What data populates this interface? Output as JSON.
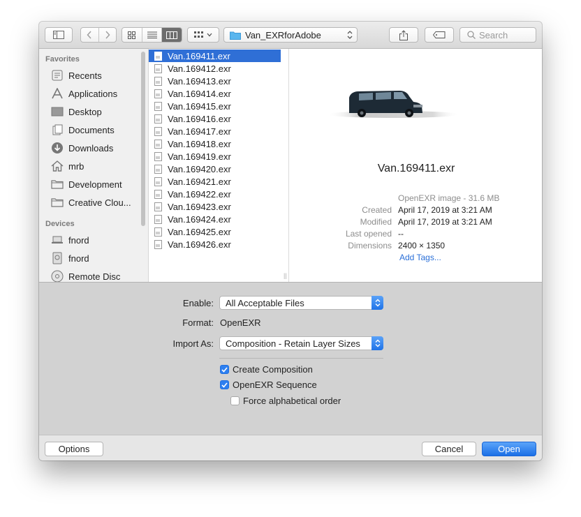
{
  "toolbar": {
    "path_label": "Van_EXRforAdobe",
    "search_placeholder": "Search"
  },
  "sidebar": {
    "favorites_header": "Favorites",
    "favorites": [
      {
        "label": "Recents",
        "icon": "recents-icon"
      },
      {
        "label": "Applications",
        "icon": "applications-icon"
      },
      {
        "label": "Desktop",
        "icon": "desktop-icon"
      },
      {
        "label": "Documents",
        "icon": "documents-icon"
      },
      {
        "label": "Downloads",
        "icon": "downloads-icon"
      },
      {
        "label": "mrb",
        "icon": "home-icon"
      },
      {
        "label": "Development",
        "icon": "folder-icon"
      },
      {
        "label": "Creative Clou...",
        "icon": "folder-icon"
      }
    ],
    "devices_header": "Devices",
    "devices": [
      {
        "label": "fnord",
        "icon": "laptop-icon"
      },
      {
        "label": "fnord",
        "icon": "drive-icon"
      },
      {
        "label": "Remote Disc",
        "icon": "disc-icon"
      }
    ]
  },
  "files": [
    "Van.169411.exr",
    "Van.169412.exr",
    "Van.169413.exr",
    "Van.169414.exr",
    "Van.169415.exr",
    "Van.169416.exr",
    "Van.169417.exr",
    "Van.169418.exr",
    "Van.169419.exr",
    "Van.169420.exr",
    "Van.169421.exr",
    "Van.169422.exr",
    "Van.169423.exr",
    "Van.169424.exr",
    "Van.169425.exr",
    "Van.169426.exr"
  ],
  "selected_file_index": 0,
  "preview": {
    "name": "Van.169411.exr",
    "kind": "OpenEXR image - 31.6 MB",
    "created_label": "Created",
    "created": "April 17, 2019 at 3:21 AM",
    "modified_label": "Modified",
    "modified": "April 17, 2019 at 3:21 AM",
    "last_opened_label": "Last opened",
    "last_opened": "--",
    "dimensions_label": "Dimensions",
    "dimensions": "2400 × 1350",
    "add_tags": "Add Tags..."
  },
  "options": {
    "enable_label": "Enable:",
    "enable_value": "All Acceptable Files",
    "format_label": "Format:",
    "format_value": "OpenEXR",
    "import_as_label": "Import As:",
    "import_as_value": "Composition - Retain Layer Sizes",
    "create_composition": {
      "label": "Create Composition",
      "checked": true
    },
    "openexr_sequence": {
      "label": "OpenEXR Sequence",
      "checked": true
    },
    "force_alpha_order": {
      "label": "Force alphabetical order",
      "checked": false
    }
  },
  "buttons": {
    "options": "Options",
    "cancel": "Cancel",
    "open": "Open"
  },
  "colors": {
    "selection": "#2f6fd6",
    "accent": "#1b6fe6"
  }
}
